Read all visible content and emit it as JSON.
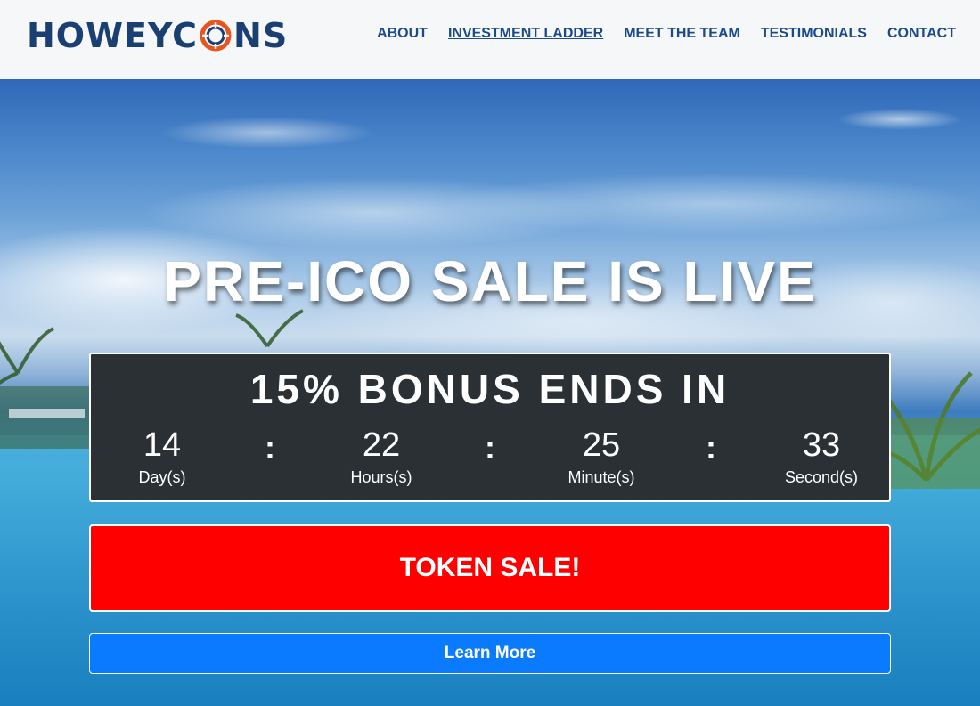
{
  "header": {
    "logo": {
      "part1": "HOW",
      "part2": "EYC",
      "part3": "NS"
    },
    "nav": [
      {
        "label": "ABOUT",
        "active": false
      },
      {
        "label": "INVESTMENT LADDER",
        "active": true
      },
      {
        "label": "MEET THE TEAM",
        "active": false
      },
      {
        "label": "TESTIMONIALS",
        "active": false
      },
      {
        "label": "CONTACT",
        "active": false
      }
    ]
  },
  "hero": {
    "headline": "PRE-ICO SALE IS LIVE",
    "countdown": {
      "title": "15% BONUS ENDS IN",
      "separator": ":",
      "units": [
        {
          "value": "14",
          "label": "Day(s)"
        },
        {
          "value": "22",
          "label": "Hours(s)"
        },
        {
          "value": "25",
          "label": "Minute(s)"
        },
        {
          "value": "33",
          "label": "Second(s)"
        }
      ]
    },
    "token_button": "TOKEN SALE!",
    "learn_button": "Learn More"
  },
  "colors": {
    "brand_navy": "#1a3f72",
    "nav_blue": "#1b4a8c",
    "coin_orange": "#e8541e",
    "token_red": "#ff0000",
    "learn_blue": "#0a7bff",
    "countdown_bg": "#2b3034"
  },
  "icons": [
    "coin-logo-icon"
  ]
}
